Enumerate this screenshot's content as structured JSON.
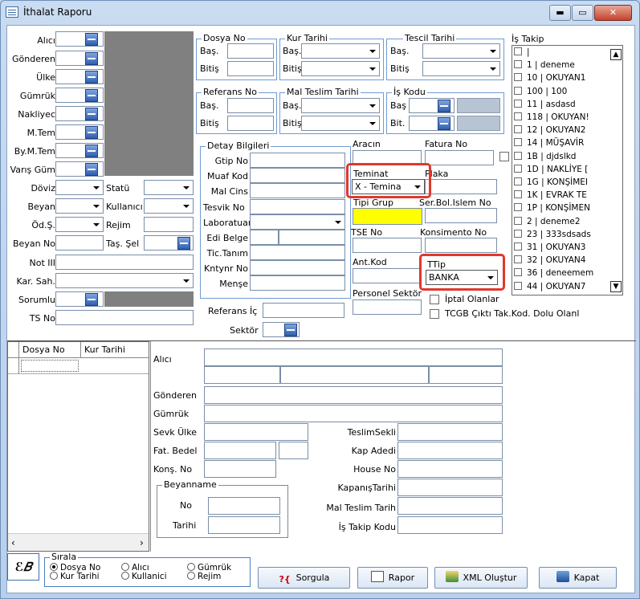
{
  "window": {
    "title": "İthalat Raporu",
    "min": "▬",
    "max": "▭",
    "close": "✕"
  },
  "left_fields": {
    "alici": "Alıcı",
    "gonderen": "Gönderen",
    "ulke": "Ülke",
    "gumruk": "Gümrük",
    "nakliyeci": "Nakliyec",
    "m_tem": "M.Tem",
    "by_m_tem": "By.M.Tem",
    "varis": "Varış Güm",
    "doviz": "Döviz",
    "statu": "Statü",
    "beyan": "Beyan",
    "kullanici": "Kullanıcı",
    "od_s": "Öd.Ş.",
    "rejim": "Rejim",
    "beyan_no": "Beyan No",
    "tas_sekli": "Taş. Şel",
    "not": "Not III",
    "kar_sah": "Kar. Sah.",
    "sorumlu": "Sorumlu",
    "ts_no": "TS No"
  },
  "groups": {
    "dosya_no": "Dosya No",
    "kur_tarihi": "Kur Tarihi",
    "tescil_tarihi": "Tescil Tarihi",
    "referans_no": "Referans No",
    "mal_teslim_tarihi": "Mal Teslim Tarihi",
    "is_kodu": "İş Kodu",
    "detay_bilgileri": "Detay Bilgileri",
    "bas": "Baş.",
    "bitis": "Bitiş",
    "bas2": "Baş",
    "bit": "Bit."
  },
  "detay": {
    "gtip": "Gtip No",
    "muaf": "Muaf Kod",
    "mal_cins": "Mal Cins",
    "tesvik": "Tesvik No",
    "laboratuar": "Laboratuar",
    "edi": "Edi Belge",
    "tic_tanim": "Tic.Tanım",
    "kntynr": "Kntynr No",
    "mense": "Menşe",
    "referans_ic": "Referans İç",
    "sektor": "Sektör"
  },
  "right": {
    "aracin": "Aracın",
    "fatura_no": "Fatura No",
    "teminat": "Teminat",
    "teminat_value": "X - Temina",
    "plaka": "Plaka",
    "tipi_grup": "Tipi Grup",
    "ser_bol": "Ser.Bol.Islem No",
    "tse_no": "TSE No",
    "konsimento": "Konsimento No",
    "ant_kod": "Ant.Kod",
    "ttip": "TTip",
    "ttip_value": "BANKA",
    "personel": "Personel Sektör",
    "iptal": "İptal Olanlar",
    "tcgb": "TCGB Çıktı Tak.Kod. Dolu Olanl"
  },
  "is_takip": {
    "title": "İş Takip",
    "items": [
      "|",
      "1 | deneme",
      "10 | OKUYAN1",
      "100 | 100",
      "11 | asdasd",
      "118 | OKUYAN!",
      "12 | OKUYAN2",
      "14 | MÜŞAVİR",
      "1B | djdslkd",
      "1D | NAKLİYE [",
      "1G | KONŞİMEI",
      "1K | EVRAK TE",
      "1P | KONŞİMEN",
      "2 | deneme2",
      "23 | 333sdsads",
      "31 | OKUYAN3",
      "32 | OKUYAN4",
      "36 | deneemem",
      "44 | OKUYAN7"
    ]
  },
  "grid": {
    "col1": "Dosya No",
    "col2": "Kur Tarihi"
  },
  "detail": {
    "alici": "Alıcı",
    "gonderen": "Gönderen",
    "gumruk": "Gümrük",
    "sevk_ulke": "Sevk Ülke",
    "teslim_sekli": "TeslimSekli",
    "fat_bedel": "Fat. Bedel",
    "kap_adedi": "Kap Adedi",
    "kons_no": "Konş. No",
    "house_no": "House No",
    "beyanname": "Beyanname",
    "kapanis": "KapanışTarihi",
    "no": "No",
    "mal_teslim": "Mal Teslim Tarih",
    "tarihi": "Tarihi",
    "is_takip_kodu": "İş Takip Kodu"
  },
  "footer": {
    "logo": "ℰ𝐵",
    "sirala": "Sırala",
    "dosya_no": "Dosya No",
    "alici": "Alıcı",
    "gumruk": "Gümrük",
    "kur_tarihi": "Kur Tarihi",
    "kullanici": "Kullanici",
    "rejim": "Rejim",
    "sorgula": "Sorgula",
    "rapor": "Rapor",
    "xml": "XML Oluştur",
    "kapat": "Kapat"
  }
}
